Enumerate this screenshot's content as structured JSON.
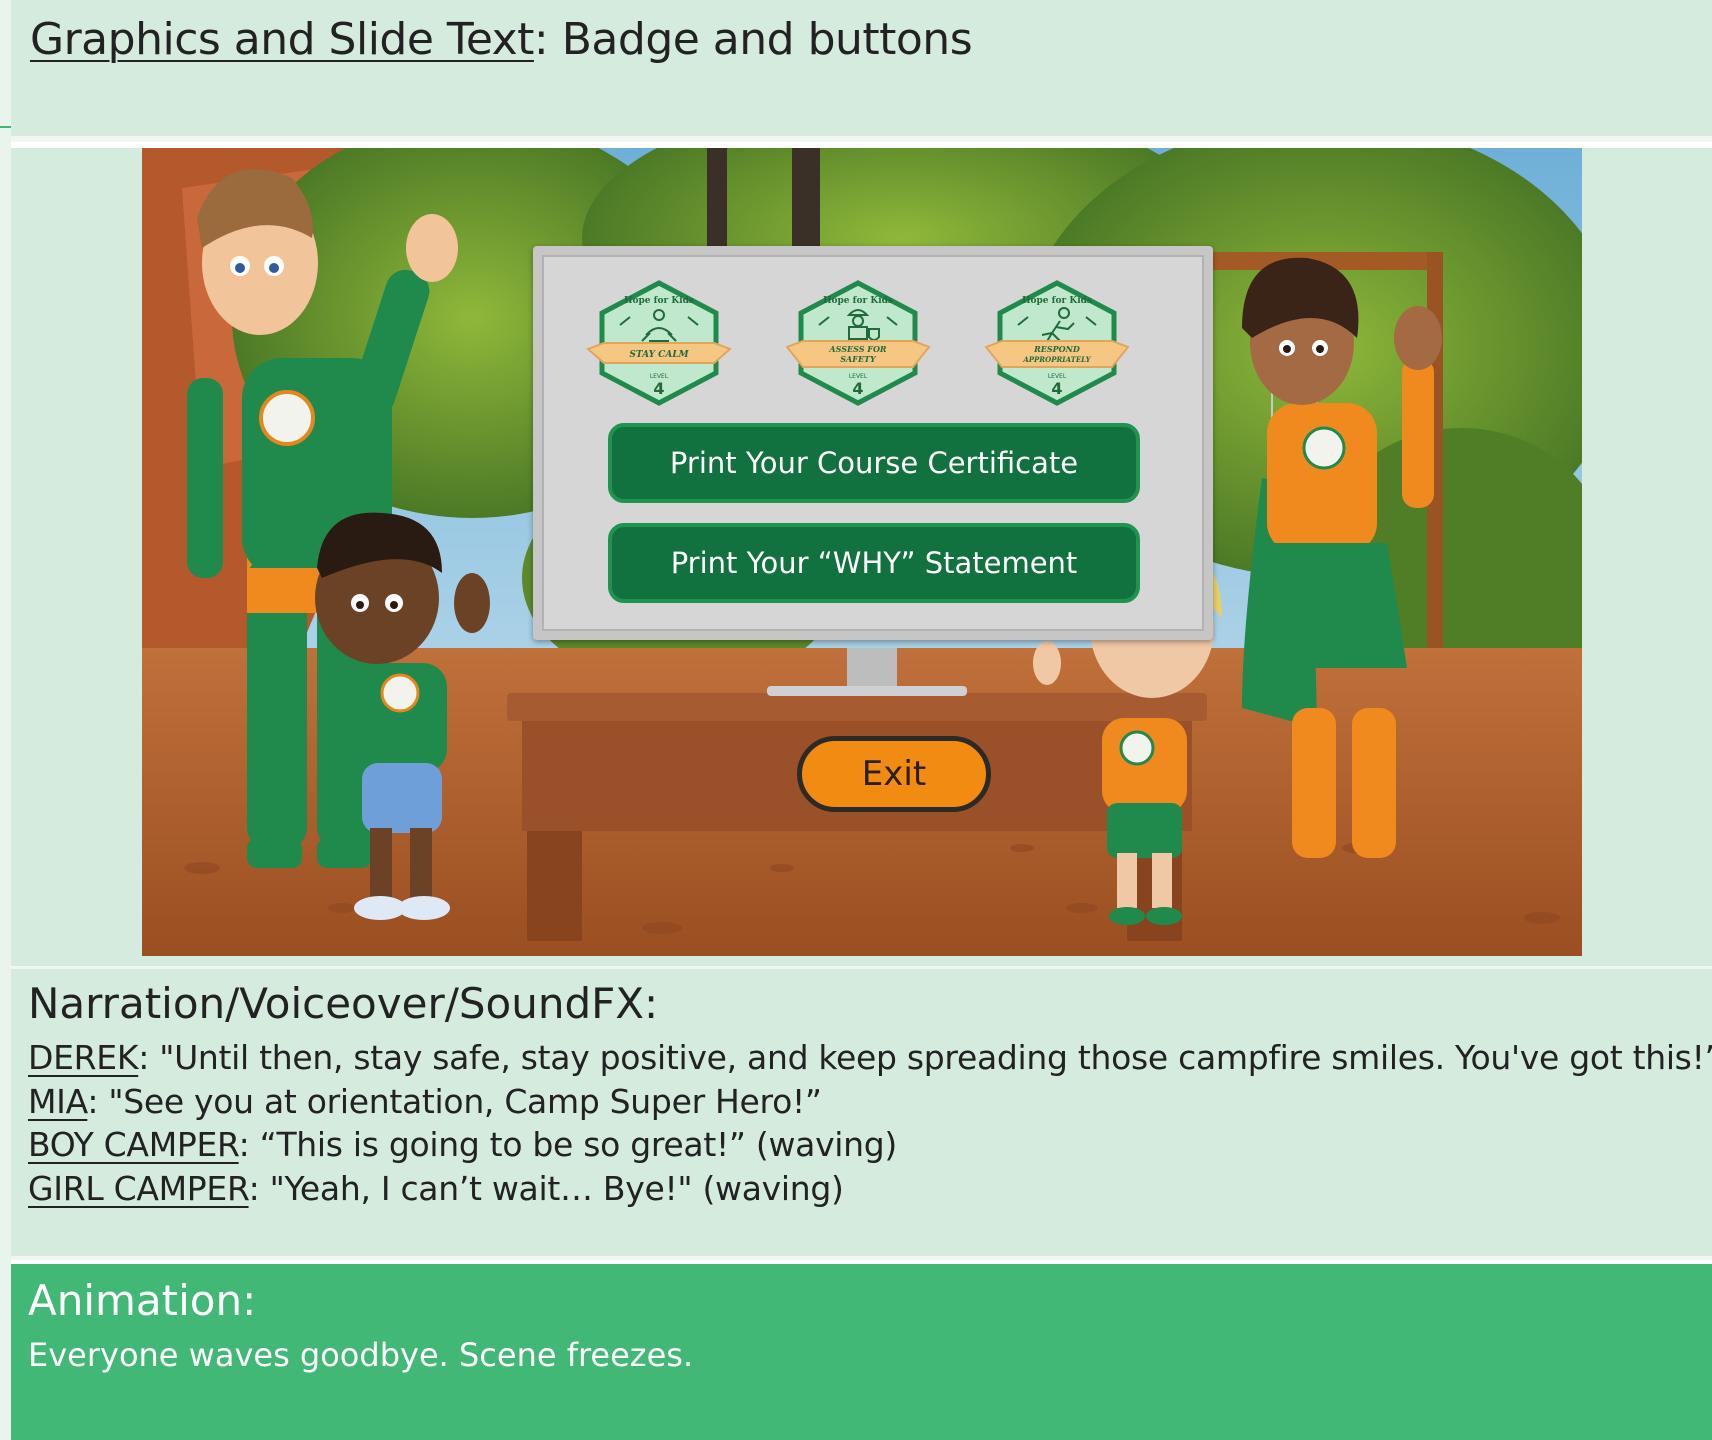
{
  "graphics": {
    "label": "Graphics and Slide Text",
    "separator": ":",
    "value": " Badge and buttons"
  },
  "slide": {
    "badges": [
      {
        "brand": "Hope for Kids",
        "title": "STAY CALM",
        "level_label": "LEVEL",
        "level": "4",
        "icon": "meditation-icon"
      },
      {
        "brand": "Hope for Kids",
        "title": "ASSESS FOR SAFETY",
        "level_label": "LEVEL",
        "level": "4",
        "icon": "safety-worker-icon"
      },
      {
        "brand": "Hope for Kids",
        "title": "RESPOND APPROPRIATELY",
        "level_label": "LEVEL",
        "level": "4",
        "icon": "running-icon"
      }
    ],
    "buttons": {
      "certificate": "Print Your Course Certificate",
      "why": "Print Your “WHY” Statement",
      "exit": "Exit"
    },
    "colors": {
      "button_green": "#12723f",
      "exit_orange": "#f28b12",
      "badge_fill": "#bfe8cc",
      "badge_border": "#1f8a4c",
      "ribbon": "#f6c783"
    }
  },
  "narration": {
    "title": "Narration/Voiceover/SoundFX:",
    "lines": [
      {
        "speaker": "DEREK",
        "text": ": \"Until then, stay safe, stay positive, and keep spreading those campfire smiles. You've got this!”"
      },
      {
        "speaker": "MIA",
        "text": ": \"See you at orientation, Camp Super Hero!”"
      },
      {
        "speaker": "BOY CAMPER",
        "text": ": “This is going to be so great!” (waving)"
      },
      {
        "speaker": "GIRL CAMPER",
        "text": ": \"Yeah, I can’t wait… Bye!\" (waving)"
      }
    ]
  },
  "animation": {
    "title": "Animation:",
    "text": "Everyone waves goodbye. Scene freezes."
  }
}
